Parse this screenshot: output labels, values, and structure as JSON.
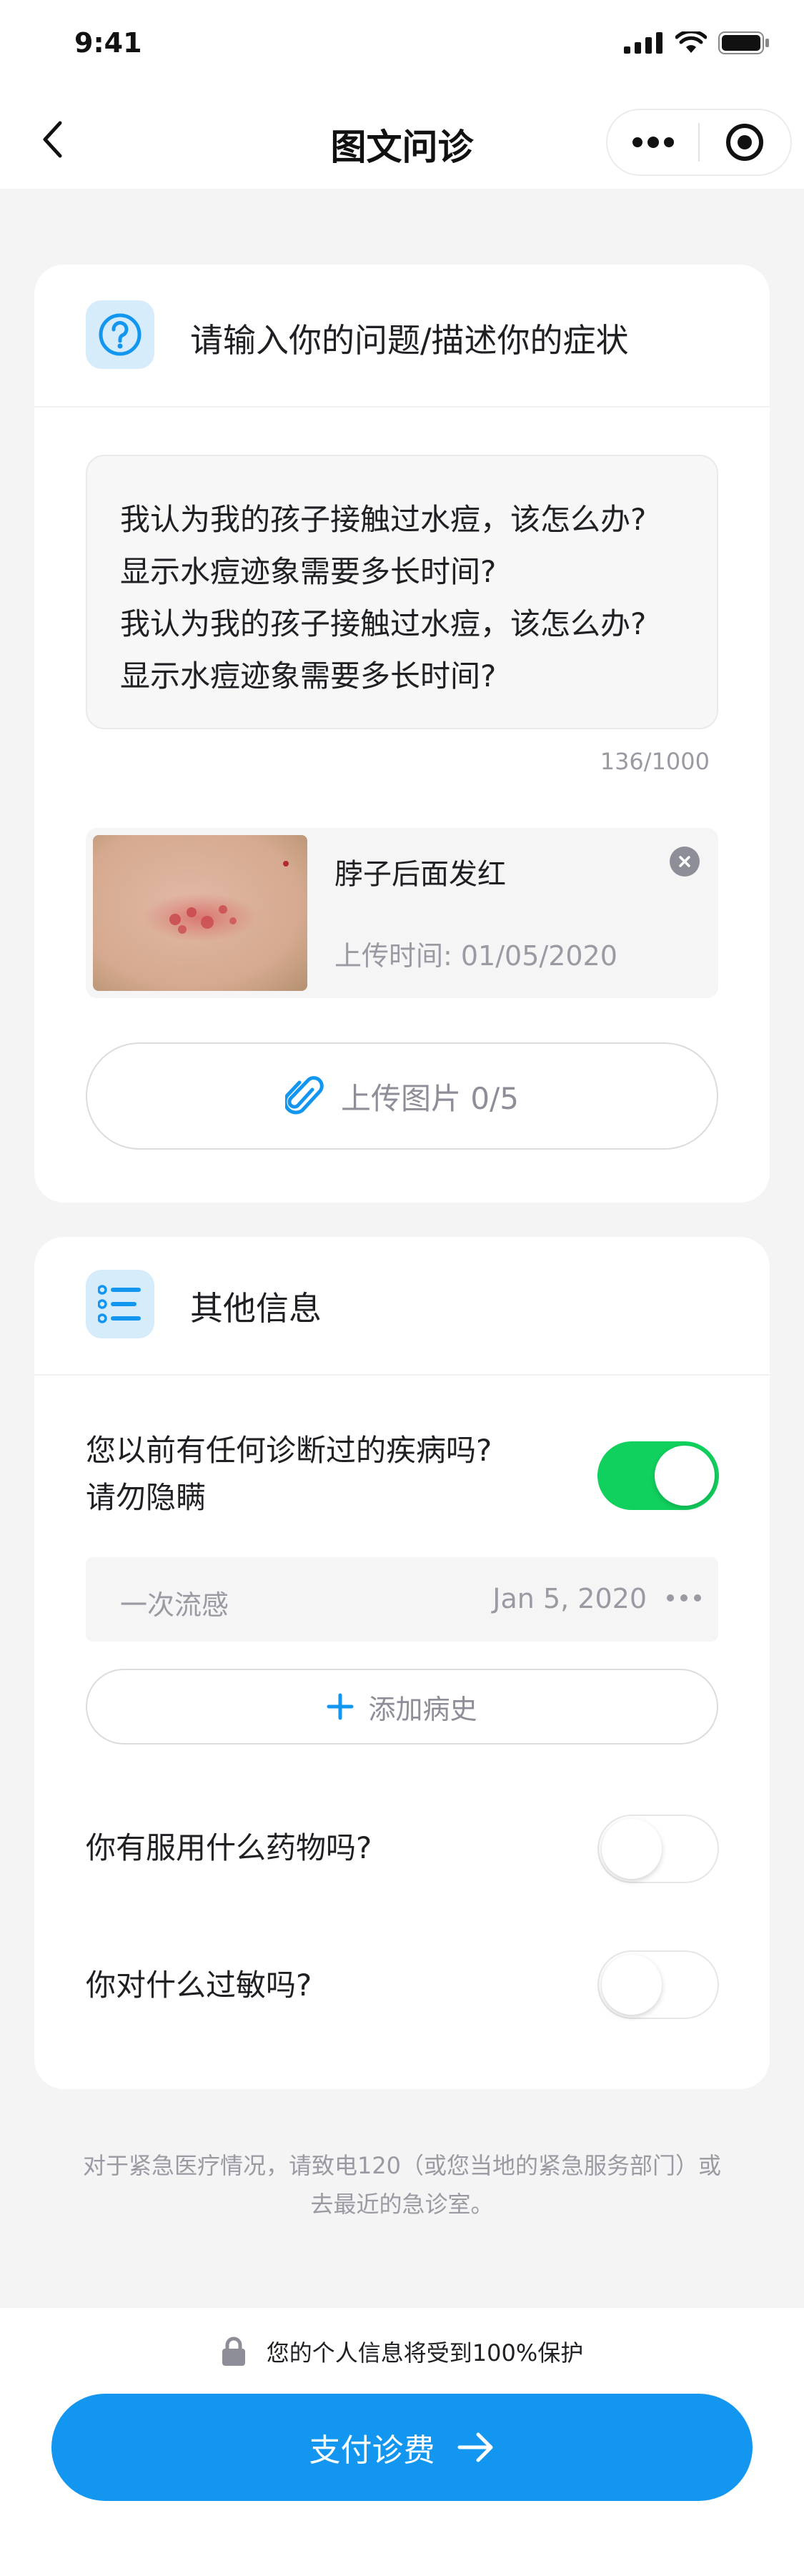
{
  "status_bar": {
    "time": "9:41"
  },
  "nav": {
    "title": "图文问诊"
  },
  "question_card": {
    "title": "请输入你的问题/描述你的症状",
    "text_lines": [
      "我认为我的孩子接触过水痘，该怎么办?",
      "显示水痘迹象需要多长时间?",
      "我认为我的孩子接触过水痘，该怎么办?",
      "显示水痘迹象需要多长时间?"
    ],
    "char_count": "136/1000",
    "upload_item": {
      "name": "脖子后面发红",
      "time": "上传时间: 01/05/2020"
    },
    "upload_button": "上传图片 0/5"
  },
  "info_card": {
    "title": "其他信息",
    "q1": {
      "line1": "您以前有任何诊断过的疾病吗?",
      "line2": "请勿隐瞒",
      "enabled": true
    },
    "history": {
      "name": "一次流感",
      "date": "Jan 5, 2020"
    },
    "add_history": "添加病史",
    "q2": {
      "text": "你有服用什么药物吗?",
      "enabled": false
    },
    "q3": {
      "text": "你对什么过敏吗?",
      "enabled": false
    }
  },
  "disclaimer": {
    "line1": "对于紧急医疗情况，请致电120（或您当地的紧急服务部门）或",
    "line2": "去最近的急诊室。"
  },
  "footer": {
    "privacy": "您的个人信息将受到100%保护",
    "pay_button": "支付诊费"
  },
  "colors": {
    "accent": "#1296f0",
    "toggle_on": "#11d15e",
    "muted_text": "#9a9aa3"
  }
}
